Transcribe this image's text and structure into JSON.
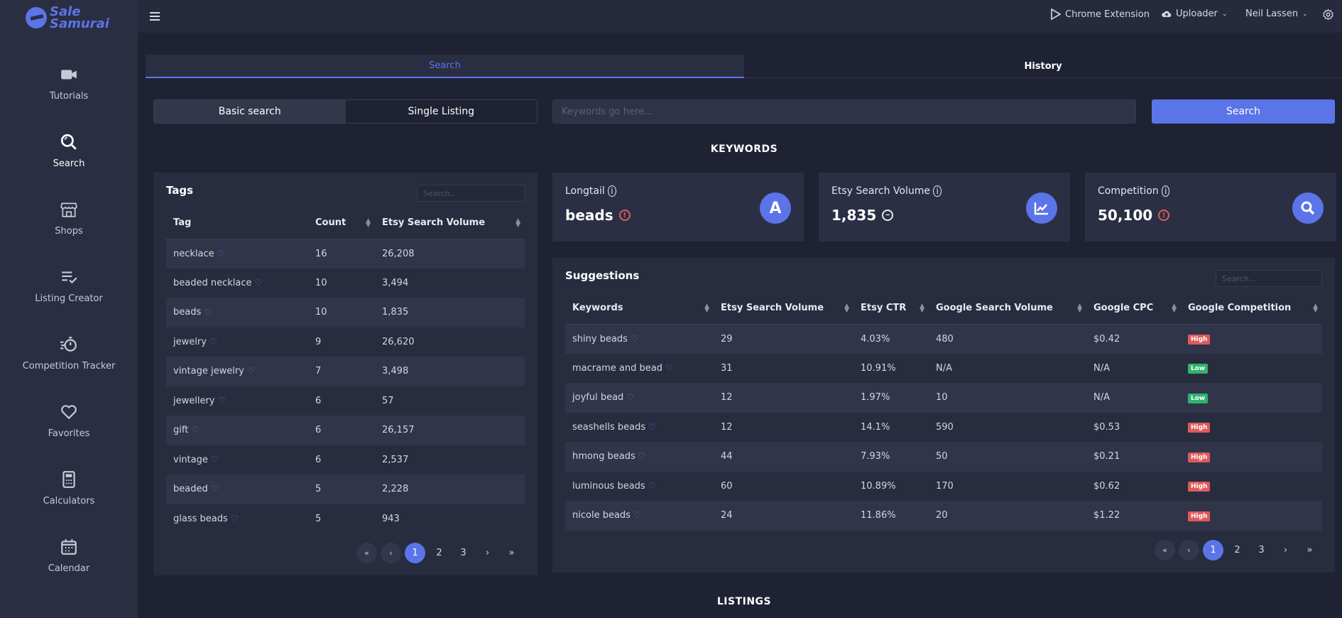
{
  "app": {
    "logo_line1": "Sale",
    "logo_line2": "Samurai"
  },
  "sidebar": {
    "items": [
      {
        "label": "Tutorials",
        "icon": "video-camera-icon"
      },
      {
        "label": "Search",
        "icon": "search-icon",
        "active": true
      },
      {
        "label": "Shops",
        "icon": "store-icon"
      },
      {
        "label": "Listing Creator",
        "icon": "list-check-icon"
      },
      {
        "label": "Competition Tracker",
        "icon": "stopwatch-icon"
      },
      {
        "label": "Favorites",
        "icon": "heart-icon"
      },
      {
        "label": "Calculators",
        "icon": "calculator-icon"
      },
      {
        "label": "Calendar",
        "icon": "calendar-icon"
      }
    ]
  },
  "topbar": {
    "chrome_extension": "Chrome Extension",
    "uploader": "Uploader",
    "user": "Neil Lassen"
  },
  "tabs": {
    "search": "Search",
    "history": "History"
  },
  "search_mode": {
    "basic": "Basic search",
    "single": "Single Listing"
  },
  "keyword_input": {
    "placeholder": "Keywords go here...",
    "value": ""
  },
  "search_button": "Search",
  "sections": {
    "keywords": "KEYWORDS",
    "listings": "LISTINGS"
  },
  "tags_panel": {
    "title": "Tags",
    "search_placeholder": "Search...",
    "columns": [
      "Tag",
      "Count",
      "Etsy Search Volume"
    ],
    "rows": [
      {
        "tag": "necklace",
        "count": "16",
        "volume": "26,208"
      },
      {
        "tag": "beaded necklace",
        "count": "10",
        "volume": "3,494"
      },
      {
        "tag": "beads",
        "count": "10",
        "volume": "1,835"
      },
      {
        "tag": "jewelry",
        "count": "9",
        "volume": "26,620"
      },
      {
        "tag": "vintage jewelry",
        "count": "7",
        "volume": "3,498"
      },
      {
        "tag": "jewellery",
        "count": "6",
        "volume": "57"
      },
      {
        "tag": "gift",
        "count": "6",
        "volume": "26,157"
      },
      {
        "tag": "vintage",
        "count": "6",
        "volume": "2,537"
      },
      {
        "tag": "beaded",
        "count": "5",
        "volume": "2,228"
      },
      {
        "tag": "glass beads",
        "count": "5",
        "volume": "943"
      }
    ],
    "pager": [
      "«",
      "‹",
      "1",
      "2",
      "3",
      "›",
      "»"
    ]
  },
  "cards": [
    {
      "label": "Longtail",
      "value": "beads",
      "icon": "A"
    },
    {
      "label": "Etsy Search Volume",
      "value": "1,835"
    },
    {
      "label": "Competition",
      "value": "50,100"
    }
  ],
  "suggestions": {
    "title": "Suggestions",
    "search_placeholder": "Search...",
    "columns": [
      "Keywords",
      "Etsy Search Volume",
      "Etsy CTR",
      "Google Search Volume",
      "Google CPC",
      "Google Competition"
    ],
    "rows": [
      {
        "keyword": "shiny beads",
        "etsy_volume": "29",
        "ctr": "4.03%",
        "google_volume": "480",
        "cpc": "$0.42",
        "competition": "High"
      },
      {
        "keyword": "macrame and bead",
        "etsy_volume": "31",
        "ctr": "10.91%",
        "google_volume": "N/A",
        "cpc": "N/A",
        "competition": "Low"
      },
      {
        "keyword": "joyful bead",
        "etsy_volume": "12",
        "ctr": "1.97%",
        "google_volume": "10",
        "cpc": "N/A",
        "competition": "Low"
      },
      {
        "keyword": "seashells beads",
        "etsy_volume": "12",
        "ctr": "14.1%",
        "google_volume": "590",
        "cpc": "$0.53",
        "competition": "High"
      },
      {
        "keyword": "hmong beads",
        "etsy_volume": "44",
        "ctr": "7.93%",
        "google_volume": "50",
        "cpc": "$0.21",
        "competition": "High"
      },
      {
        "keyword": "luminous beads",
        "etsy_volume": "60",
        "ctr": "10.89%",
        "google_volume": "170",
        "cpc": "$0.62",
        "competition": "High"
      },
      {
        "keyword": "nicole beads",
        "etsy_volume": "24",
        "ctr": "11.86%",
        "google_volume": "20",
        "cpc": "$1.22",
        "competition": "High"
      }
    ],
    "pager": [
      "«",
      "‹",
      "1",
      "2",
      "3",
      "›",
      "»"
    ]
  },
  "colors": {
    "accent": "#5b74e8",
    "high": "#e05a5a",
    "low": "#2fb36d",
    "warn": "#e05a5a"
  }
}
